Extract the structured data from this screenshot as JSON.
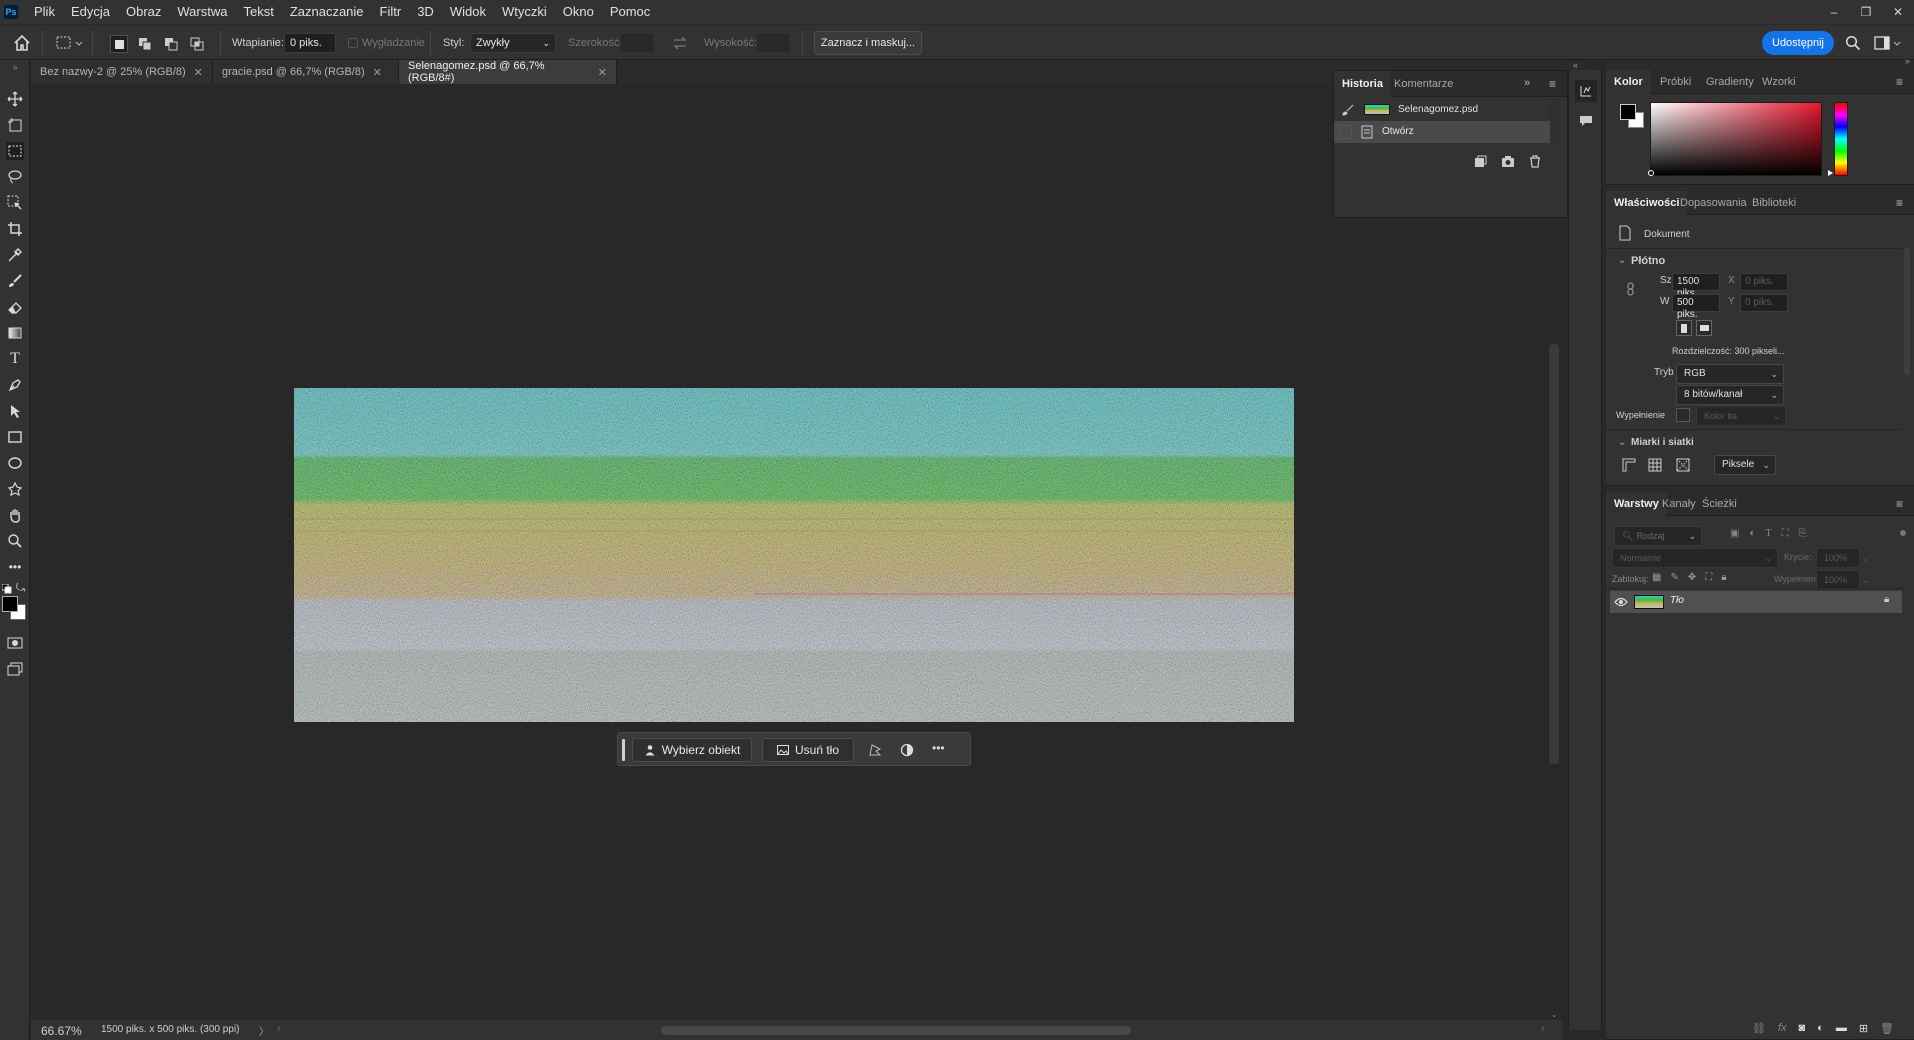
{
  "app": {
    "logo": "Ps"
  },
  "menu": [
    "Plik",
    "Edycja",
    "Obraz",
    "Warstwa",
    "Tekst",
    "Zaznaczanie",
    "Filtr",
    "3D",
    "Widok",
    "Wtyczki",
    "Okno",
    "Pomoc"
  ],
  "window_controls": {
    "minimize": "–",
    "restore": "❐",
    "close": "✕"
  },
  "options": {
    "feather_label": "Wtapianie:",
    "feather_value": "0 piks.",
    "antialias_label": "Wygładzanie",
    "style_label": "Styl:",
    "style_value": "Zwykły",
    "width_label": "Szerokość:",
    "height_label": "Wysokość:",
    "select_mask_label": "Zaznacz i maskuj...",
    "share_label": "Udostępnij"
  },
  "tabs": [
    {
      "label": "Bez nazwy-2 @ 25% (RGB/8)",
      "close": "✕"
    },
    {
      "label": "gracie.psd @ 66,7% (RGB/8)",
      "close": "✕"
    },
    {
      "label": "Selenagomez.psd @ 66,7% (RGB/8#)",
      "close": "✕"
    }
  ],
  "context_bar": {
    "select_subject": "Wybierz obiekt",
    "remove_bg": "Usuń tło",
    "more": "•••"
  },
  "status": {
    "zoom": "66.67%",
    "doc_info": "1500 piks. x 500 piks. (300 ppi)",
    "arrow": "〉"
  },
  "history": {
    "tab_history": "Historia",
    "tab_comments": "Komentarze",
    "expand": "»",
    "items": [
      {
        "label": "Selenagomez.psd"
      },
      {
        "label": "Otwórz"
      }
    ]
  },
  "color_panel": {
    "tabs": [
      "Kolor",
      "Próbki",
      "Gradienty",
      "Wzorki"
    ],
    "foreground": "#000000",
    "background": "#ffffff"
  },
  "properties": {
    "tabs": [
      "Właściwości",
      "Dopasowania",
      "Biblioteki"
    ],
    "doc_label": "Dokument",
    "canvas_section": "Płótno",
    "w_label": "Sz",
    "w_value": "1500 piks.",
    "h_label": "W",
    "h_value": "500 piks.",
    "x_label": "X",
    "x_value": "0 piks.",
    "y_label": "Y",
    "y_value": "0 piks.",
    "resolution": "Rozdzielczość: 300 pikseli...",
    "mode_label": "Tryb",
    "mode_value": "RGB",
    "depth_value": "8 bitów/kanał",
    "fill_label": "Wypełnienie",
    "fill_value": "Kolor tła",
    "rulers_section": "Miarki i siatki",
    "units_value": "Piksele"
  },
  "layers": {
    "tabs": [
      "Warstwy",
      "Kanały",
      "Ścieżki"
    ],
    "filter_placeholder": "Rodzaj",
    "blend_mode": "Normalnie",
    "opacity_label": "Krycie:",
    "opacity_value": "100%",
    "lock_label": "Zablokuj:",
    "fill_label": "Wypełnienie:",
    "fill_value": "100%",
    "items": [
      {
        "name": "Tło"
      }
    ]
  },
  "colors": {
    "accent": "#1473e6",
    "bg_dark": "#282828",
    "panel": "#323232"
  }
}
